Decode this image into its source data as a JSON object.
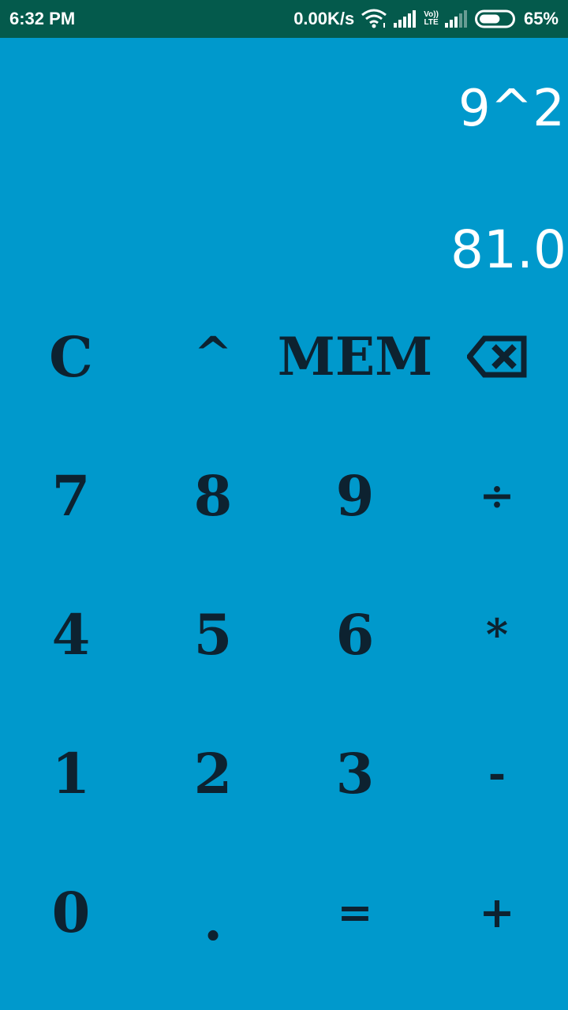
{
  "status_bar": {
    "time": "6:32 PM",
    "network_speed": "0.00K/s",
    "volte_label": "Vo))",
    "lte_label": "LTE",
    "battery_percent": "65%",
    "battery_level": 0.65,
    "icons": [
      "wifi-icon",
      "signal-icon",
      "volte-icon",
      "signal-icon",
      "battery-icon"
    ]
  },
  "display": {
    "expression": "9^2",
    "result": "81.0"
  },
  "keypad": {
    "rows": [
      [
        {
          "label": "C",
          "name": "clear-button"
        },
        {
          "label": "^",
          "name": "power-button"
        },
        {
          "label": "MEM",
          "name": "memory-button"
        },
        {
          "label": "",
          "name": "backspace-button",
          "icon": "backspace-icon"
        }
      ],
      [
        {
          "label": "7",
          "name": "digit-7-button"
        },
        {
          "label": "8",
          "name": "digit-8-button"
        },
        {
          "label": "9",
          "name": "digit-9-button"
        },
        {
          "label": "÷",
          "name": "divide-button"
        }
      ],
      [
        {
          "label": "4",
          "name": "digit-4-button"
        },
        {
          "label": "5",
          "name": "digit-5-button"
        },
        {
          "label": "6",
          "name": "digit-6-button"
        },
        {
          "label": "*",
          "name": "multiply-button"
        }
      ],
      [
        {
          "label": "1",
          "name": "digit-1-button"
        },
        {
          "label": "2",
          "name": "digit-2-button"
        },
        {
          "label": "3",
          "name": "digit-3-button"
        },
        {
          "label": "-",
          "name": "subtract-button"
        }
      ],
      [
        {
          "label": "0",
          "name": "digit-0-button"
        },
        {
          "label": ".",
          "name": "decimal-button"
        },
        {
          "label": "=",
          "name": "equals-button"
        },
        {
          "label": "+",
          "name": "add-button"
        }
      ]
    ]
  },
  "colors": {
    "background": "#0099cc",
    "status_bar": "#045a4c",
    "key_text": "#0d2230",
    "display_text": "#ffffff"
  }
}
